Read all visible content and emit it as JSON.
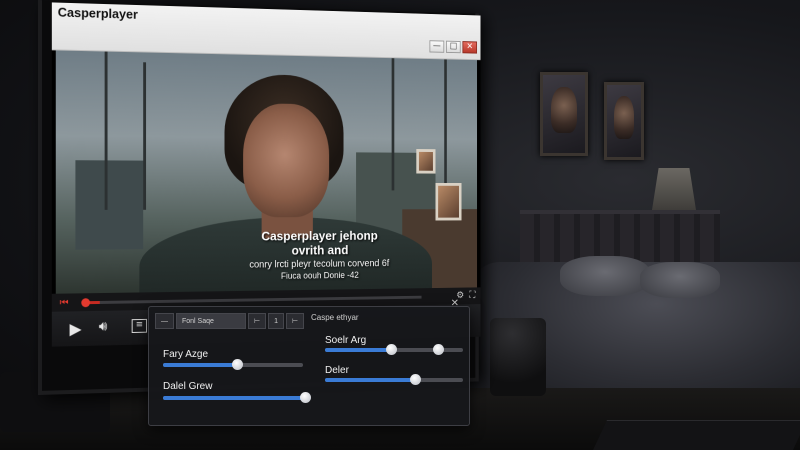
{
  "window": {
    "title": "Casperplayer",
    "minimize": "—",
    "maximize": "□",
    "close": "✕"
  },
  "subtitles": {
    "line1": "Casperplayer jehonp ovrith and",
    "line2": "conry lrcti pleyr tecolum corvend 6f",
    "line3": "Fiuca oouh Donie -42"
  },
  "player": {
    "progress": 0.03,
    "play_icon": "play-icon",
    "volume_icon": "volume-icon",
    "menu_icon": "menu-icon"
  },
  "dialog": {
    "title": "Caspe ethyar",
    "close": "✕",
    "tabs": [
      "—",
      "Fonl Saqe",
      "⊢",
      "1",
      "⊢"
    ],
    "sliders": [
      {
        "label": "Fary Azge",
        "value": 0.53
      },
      {
        "label": "Dalel Grew",
        "value": 0.96
      },
      {
        "label": "Soelr Arg",
        "value": 0.48,
        "value2": 0.82
      },
      {
        "label": "Deler",
        "value": 0.65
      }
    ]
  },
  "colors": {
    "accent": "#3a7bd5",
    "seek": "#c62b22"
  }
}
